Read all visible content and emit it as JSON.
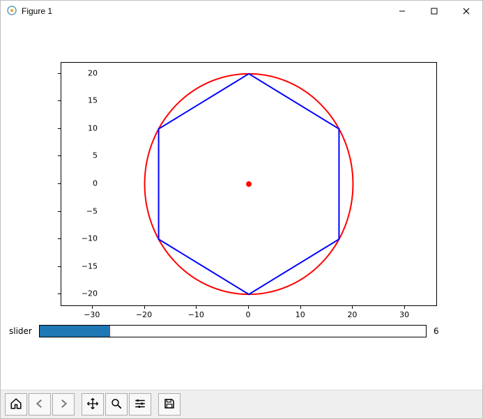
{
  "window": {
    "title": "Figure 1"
  },
  "titlebar_buttons": {
    "minimize": "minimize-icon",
    "maximize": "maximize-icon",
    "close": "close-icon"
  },
  "slider": {
    "label": "slider",
    "value": "6",
    "min": 3,
    "max": 30,
    "fill_percent": 18
  },
  "toolbar": {
    "home": "home-icon",
    "back": "back-icon",
    "forward": "forward-icon",
    "pan": "pan-icon",
    "zoom": "zoom-icon",
    "configure": "configure-icon",
    "save": "save-icon"
  },
  "axes": {
    "x_ticks": [
      "−30",
      "−20",
      "−10",
      "0",
      "10",
      "20",
      "30"
    ],
    "y_ticks": [
      "−20",
      "−15",
      "−10",
      "−5",
      "0",
      "5",
      "10",
      "15",
      "20"
    ],
    "xlim": [
      -36,
      36
    ],
    "ylim": [
      -22,
      22
    ]
  },
  "chart_data": {
    "type": "line",
    "title": "",
    "xlabel": "",
    "ylabel": "",
    "xlim": [
      -36,
      36
    ],
    "ylim": [
      -22,
      22
    ],
    "series": [
      {
        "name": "circle",
        "color": "#ff0000",
        "shape": "circle",
        "center": [
          0,
          0
        ],
        "radius": 20
      },
      {
        "name": "polygon",
        "color": "#0000ff",
        "shape": "polygon",
        "sides": 6,
        "x": [
          0,
          17.32,
          17.32,
          0,
          -17.32,
          -17.32,
          0
        ],
        "y": [
          20,
          10,
          -10,
          -20,
          -10,
          10,
          20
        ]
      },
      {
        "name": "center",
        "color": "#ff0000",
        "shape": "point",
        "x": [
          0
        ],
        "y": [
          0
        ]
      }
    ]
  }
}
